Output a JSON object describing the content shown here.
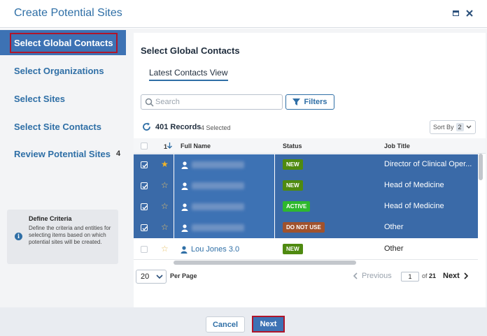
{
  "window": {
    "title": "Create Potential Sites"
  },
  "sidebar": {
    "items": [
      {
        "label": "Select Global Contacts"
      },
      {
        "label": "Select Organizations"
      },
      {
        "label": "Select Sites"
      },
      {
        "label": "Select Site Contacts"
      },
      {
        "label": "Review Potential Sites",
        "count": "4"
      }
    ],
    "info": {
      "title": "Define Criteria",
      "text": "Define the criteria and entities for selecting items based on which potential sites will be created."
    }
  },
  "main": {
    "title": "Select Global Contacts",
    "view_tab": "Latest Contacts View",
    "search_placeholder": "Search",
    "filters_label": "Filters",
    "records_label": "401 Records",
    "selected_label": "4 Selected",
    "sort_by_label": "Sort By",
    "sort_by_count": "2",
    "table": {
      "sort_indicator": "1",
      "columns": [
        "Full Name",
        "Status",
        "Job Title"
      ],
      "rows": [
        {
          "name": "",
          "status": "NEW",
          "job": "Director of Clinical Oper...",
          "selected": true
        },
        {
          "name": "",
          "status": "NEW",
          "job": "Head of Medicine",
          "selected": true
        },
        {
          "name": "",
          "status": "ACTIVE",
          "job": "Head of Medicine",
          "selected": true
        },
        {
          "name": "",
          "status": "DO NOT USE",
          "job": "Other",
          "selected": true
        },
        {
          "name": "Lou Jones 3.0",
          "status": "NEW",
          "job": "Other",
          "selected": false
        }
      ]
    },
    "pagination": {
      "per_page": "20",
      "per_page_label": "Per Page",
      "previous": "Previous",
      "current_page": "1",
      "of_label": "of",
      "total_pages": "21",
      "next": "Next"
    }
  },
  "footer": {
    "cancel": "Cancel",
    "next": "Next"
  },
  "colors": {
    "accent": "#2f6fa6",
    "selected_row": "#3a6aa8",
    "status_new": "#4f8a10",
    "status_active": "#2eb82e",
    "status_do_not_use": "#a0522d",
    "star": "#f0b429",
    "highlight_border": "#b0152a"
  }
}
